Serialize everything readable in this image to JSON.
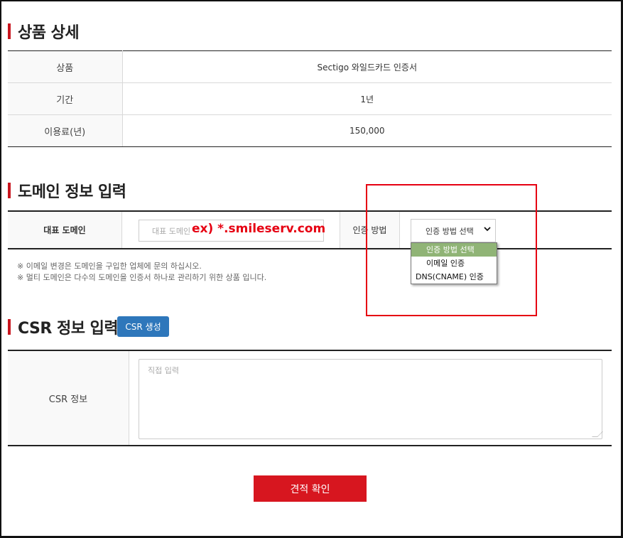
{
  "product_section": {
    "title": "상품 상세",
    "rows": [
      {
        "label": "상품",
        "value": "Sectigo 와일드카드 인증서"
      },
      {
        "label": "기간",
        "value": "1년"
      },
      {
        "label": "이용료(년)",
        "value": "150,000"
      }
    ]
  },
  "domain_section": {
    "title": "도메인 정보 입력",
    "main_domain_label": "대표 도메인",
    "domain_input_placeholder": "대표 도메인",
    "overlay_example": "ex) *.smileserv.com",
    "auth_method_label": "인증 방법",
    "auth_select_value": "인증 방법 선택",
    "auth_options": [
      "인증 방법 선택",
      "이메일 인증",
      "DNS(CNAME) 인증"
    ],
    "notes": [
      "※ 이메일 변경은 도메인을 구입한 업체에 문의 하십시오.",
      "※ 멀티 도메인은 다수의 도메인을 인증서 하나로 관리하기 위한 상품 입니다."
    ]
  },
  "csr_section": {
    "title": "CSR 정보 입력",
    "generate_button": "CSR 생성",
    "csr_label": "CSR 정보",
    "csr_placeholder": "직접 입력"
  },
  "submit_button": "견적 확인",
  "colors": {
    "accent_red": "#d7161f",
    "highlight_red": "#e60012",
    "button_blue": "#2e77bb",
    "selected_option": "#90b476"
  }
}
